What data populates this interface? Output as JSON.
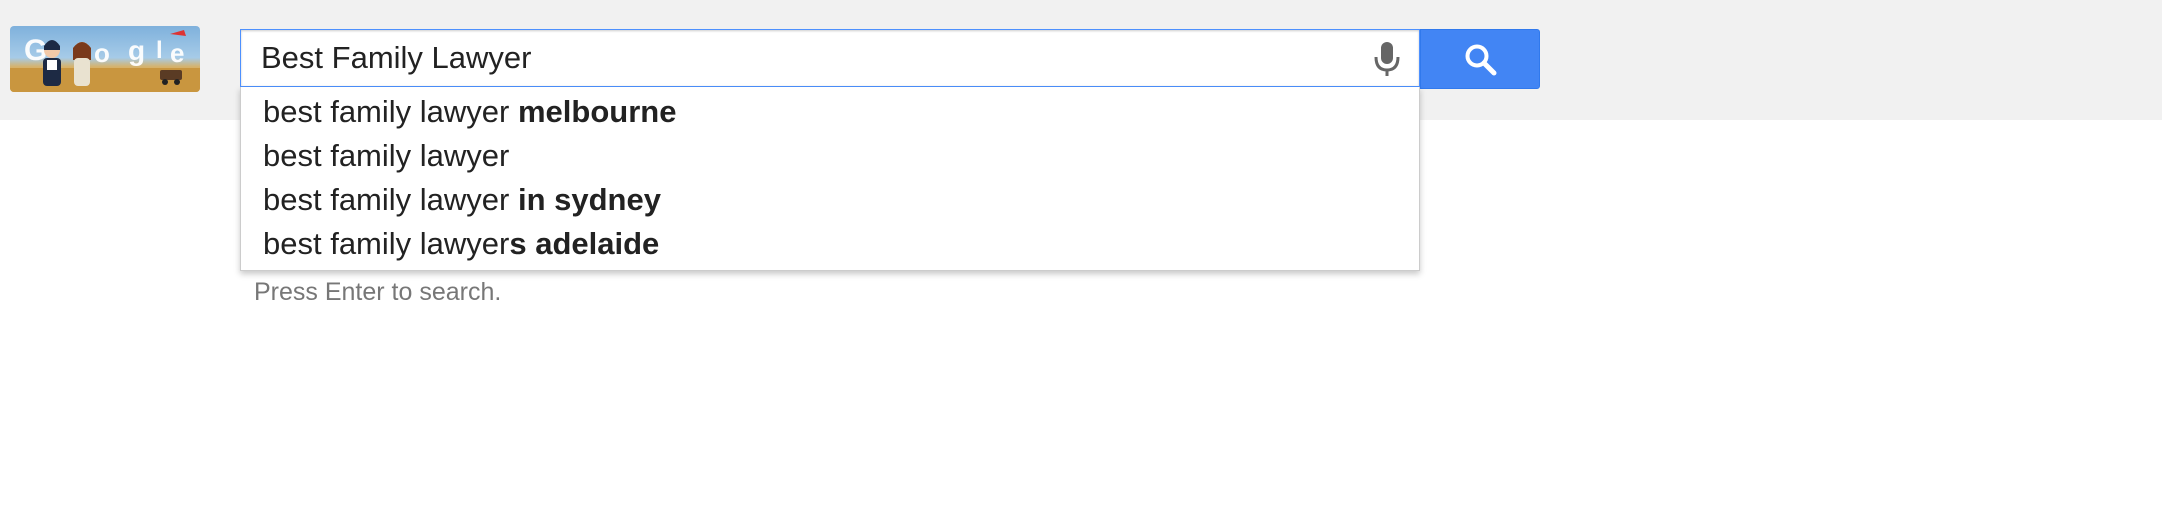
{
  "logo": {
    "icon": "google-doodle-logo",
    "letters": "Google"
  },
  "search": {
    "value": "Best Family Lawyer",
    "mic_icon": "microphone-icon",
    "button_icon": "magnifier-icon",
    "accent_color": "#4285f4"
  },
  "suggestions": [
    {
      "prefix": "best family lawyer ",
      "completion": "melbourne"
    },
    {
      "prefix": "best family lawyer",
      "completion": ""
    },
    {
      "prefix": "best family lawyer ",
      "completion": "in sydney"
    },
    {
      "prefix": "best family lawyer",
      "completion": "s adelaide"
    }
  ],
  "hint": "Press Enter to search."
}
